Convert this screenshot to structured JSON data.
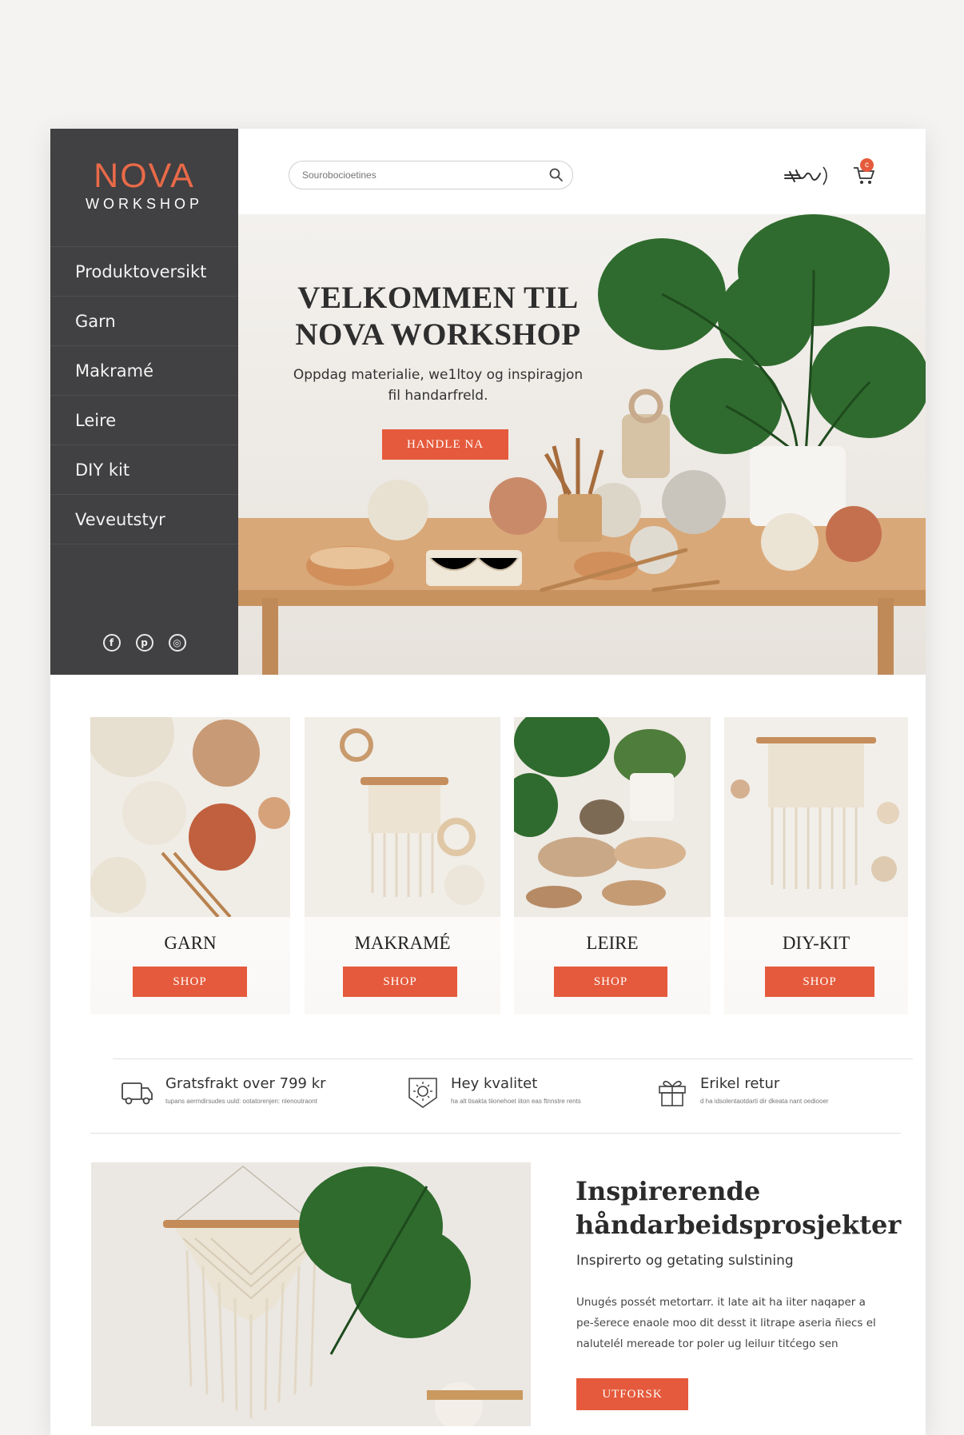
{
  "brand": {
    "name": "NOVA",
    "sub": "WORKSHOP",
    "accent": "#e55a3c",
    "sidebar_bg": "#414042"
  },
  "sidebar": {
    "items": [
      {
        "label": "Produktoversikt"
      },
      {
        "label": "Garn"
      },
      {
        "label": "Makramé"
      },
      {
        "label": "Leire"
      },
      {
        "label": "DIY  kit"
      },
      {
        "label": "Veveutstyr"
      }
    ],
    "socials": [
      "facebook-icon",
      "pinterest-icon",
      "instagram-icon"
    ]
  },
  "header": {
    "search_placeholder": "Sourobocioetines",
    "cart_count": "c"
  },
  "hero": {
    "title": "VELKOMMEN TIL NOVA WORKSHOP",
    "subtitle": "Oppdag materialie, we1ltoy og inspiragjon fil handarfreld.",
    "cta": "HANDLE NA"
  },
  "categories": [
    {
      "title": "GARN",
      "cta": "SHOP"
    },
    {
      "title": "MAKRAMÉ",
      "cta": "SHOP"
    },
    {
      "title": "LEIRE",
      "cta": "SHOP"
    },
    {
      "title": "DIY-KIT",
      "cta": "SHOP"
    }
  ],
  "features": [
    {
      "icon": "truck-icon",
      "title": "Gratsfrakt over 799 kr",
      "text": "tupans aermdirsudes uuld: ootatorenjen: nlenoutraont"
    },
    {
      "icon": "shield-icon",
      "title": "Hey kvalitet",
      "text": "ha alt tisakta tiionehoet iiton eas ftnnstre rents"
    },
    {
      "icon": "gift-icon",
      "title": "Erikel retur",
      "text": "d ha idsolentaotdarti dir dkeata nant oediooer"
    }
  ],
  "inspiration": {
    "title": "Inspirerende håndarbeidsprosjekter",
    "subtitle": "Inspirerto og getating sulstining",
    "text": "Unugés possét metortarr. it late ait ha iiter naqaper a pe-šerece enaole moo dit desst it litrape aseria ñiecs el nalutelél mereade tor poler ug leiluır titćego sen",
    "cta": "UTFORSK"
  }
}
